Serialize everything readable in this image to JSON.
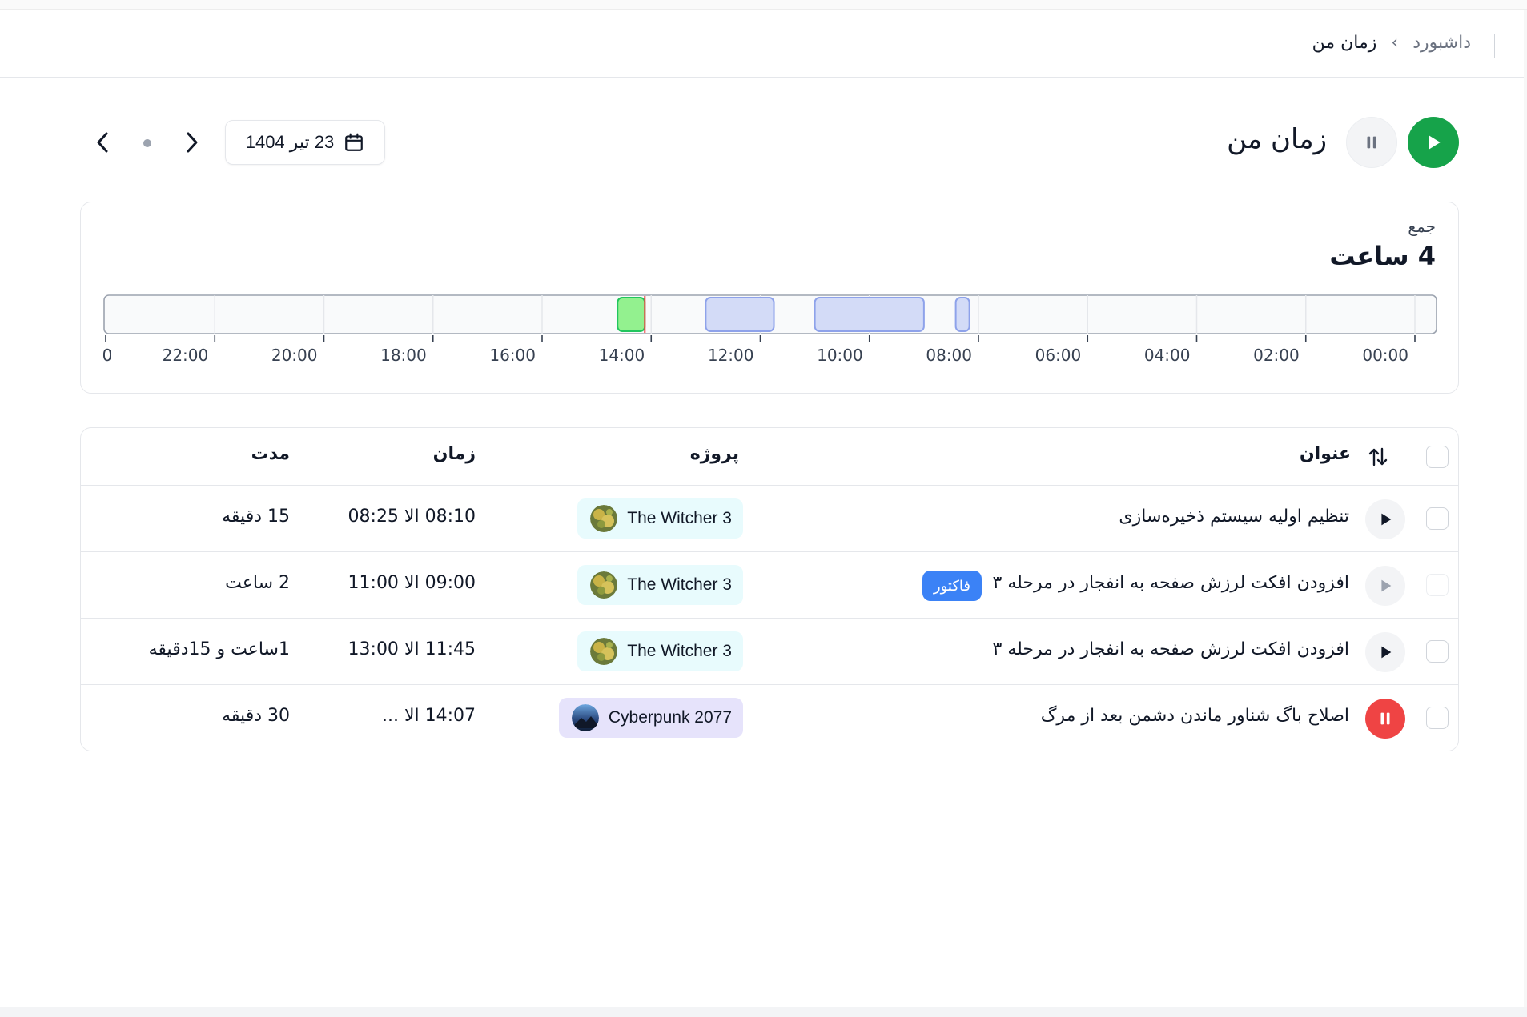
{
  "breadcrumb": {
    "home": "داشبورد",
    "separator": "›",
    "current": "زمان من"
  },
  "page": {
    "title": "زمان من",
    "date": "23 تیر 1404"
  },
  "summary": {
    "total_label": "جمع",
    "total_value": "4 ساعت"
  },
  "colors": {
    "play_green": "#16a34a",
    "stop_red": "#ef4444",
    "badge_blue": "#3b82f6",
    "block_blue": "#d3dbf7",
    "block_blue_stroke": "#8ea2ea",
    "block_green": "#93f18f",
    "block_green_stroke": "#22c55e",
    "now_line": "#ef4444",
    "pill_cyan": "#e8fbfd",
    "pill_purple": "#e6e3fb"
  },
  "chart_data": {
    "type": "timeline",
    "x_labels": [
      "00:00",
      "02:00",
      "04:00",
      "06:00",
      "08:00",
      "10:00",
      "12:00",
      "14:00",
      "16:00",
      "18:00",
      "20:00",
      "22:00",
      "0"
    ],
    "direction": "rtl",
    "range_hours": [
      0,
      24
    ],
    "blocks": [
      {
        "start": 8.1667,
        "end": 8.4167,
        "status": "done"
      },
      {
        "start": 9.0,
        "end": 11.0,
        "status": "done"
      },
      {
        "start": 11.75,
        "end": 13.0,
        "status": "done"
      },
      {
        "start": 14.1167,
        "end": 14.6167,
        "status": "running"
      }
    ],
    "now": 14.1167
  },
  "table": {
    "headers": {
      "title": "عنوان",
      "project": "پروژه",
      "time": "زمان",
      "duration": "مدت"
    },
    "sort_icon": "sort-arrows-icon",
    "rows": [
      {
        "title": "تنظیم اولیه سیستم ذخیره‌سازی",
        "badge": "",
        "project": "The Witcher 3",
        "project_theme": "witcher",
        "time": "08:10 الا 08:25",
        "duration": "15 دقیقه",
        "state": "play"
      },
      {
        "title": "افزودن افکت لرزش صفحه به انفجار در مرحله ۳",
        "badge": "فاکتور",
        "project": "The Witcher 3",
        "project_theme": "witcher",
        "time": "09:00 الا 11:00",
        "duration": "2 ساعت",
        "state": "play-disabled"
      },
      {
        "title": "افزودن افکت لرزش صفحه به انفجار در مرحله ۳",
        "badge": "",
        "project": "The Witcher 3",
        "project_theme": "witcher",
        "time": "11:45 الا 13:00",
        "duration": "1ساعت و 15دقیقه",
        "state": "play"
      },
      {
        "title": "اصلاح باگ شناور ماندن دشمن بعد از مرگ",
        "badge": "",
        "project": "Cyberpunk 2077",
        "project_theme": "cyberpunk",
        "time": "14:07 الا ...",
        "duration": "30 دقیقه",
        "state": "running"
      }
    ]
  }
}
